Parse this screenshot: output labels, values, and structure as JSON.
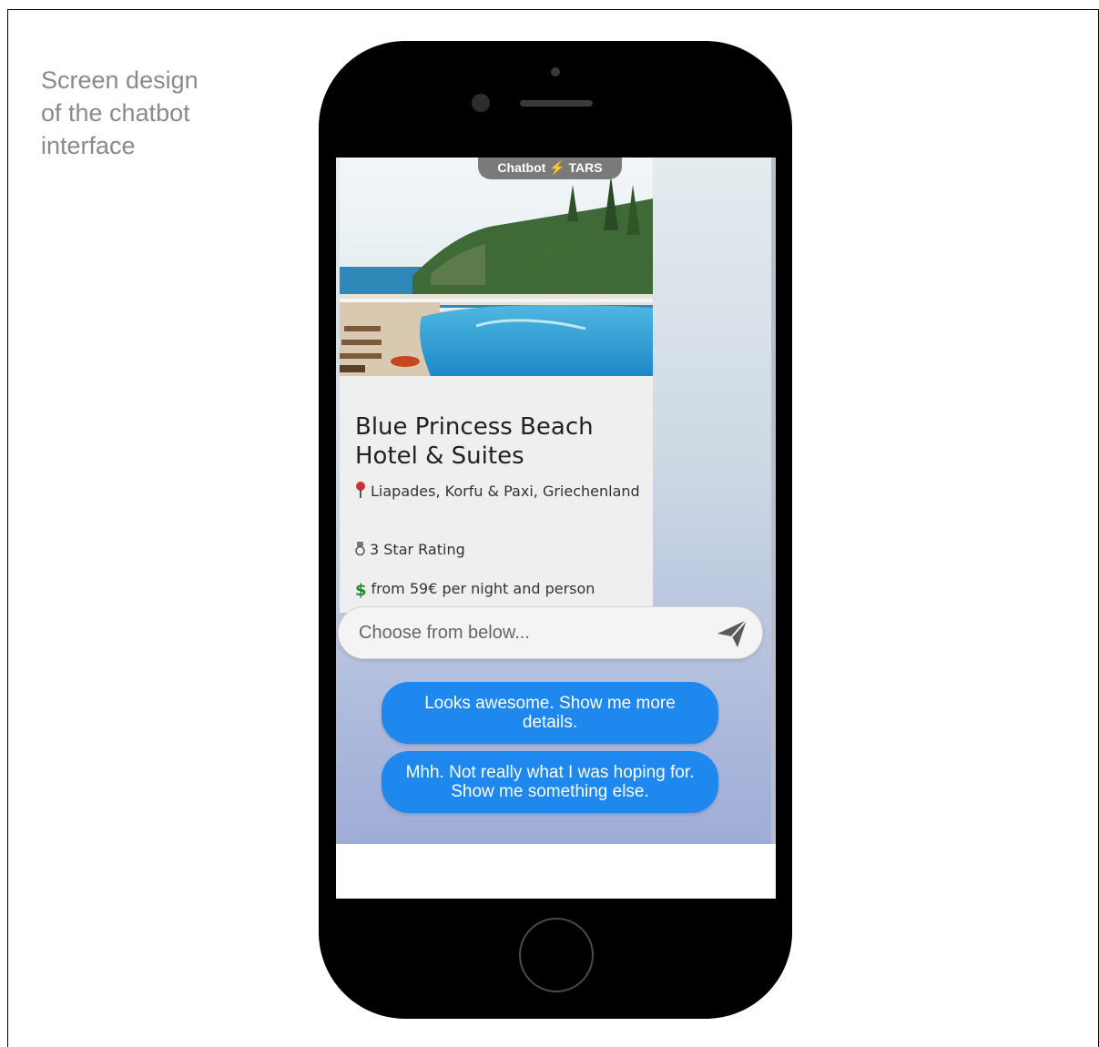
{
  "caption": {
    "line1": "Screen design",
    "line2": "of the chatbot",
    "line3": "interface"
  },
  "header": {
    "label_left": "Chatbot",
    "bolt_icon": "lightning-bolt-icon",
    "label_right": "TARS"
  },
  "hotel_card": {
    "title": "Blue Princess Beach Hotel & Suites",
    "location": "Liapades, Korfu & Paxi, Griechenland",
    "location_icon": "map-pin-icon",
    "rating": "3 Star Rating",
    "rating_icon": "medal-icon",
    "price": "from 59€ per night and person",
    "price_icon": "dollar-icon"
  },
  "composer": {
    "placeholder": "Choose from below...",
    "send_icon": "paper-plane-icon"
  },
  "quick_replies": [
    {
      "label": "Looks awesome. Show me more details."
    },
    {
      "label": "Mhh. Not really what I was hoping for. Show me something else."
    }
  ],
  "colors": {
    "reply_button": "#1e88ee",
    "header_pill": "#7a7a7a",
    "caption_text": "#8a8a8a"
  }
}
